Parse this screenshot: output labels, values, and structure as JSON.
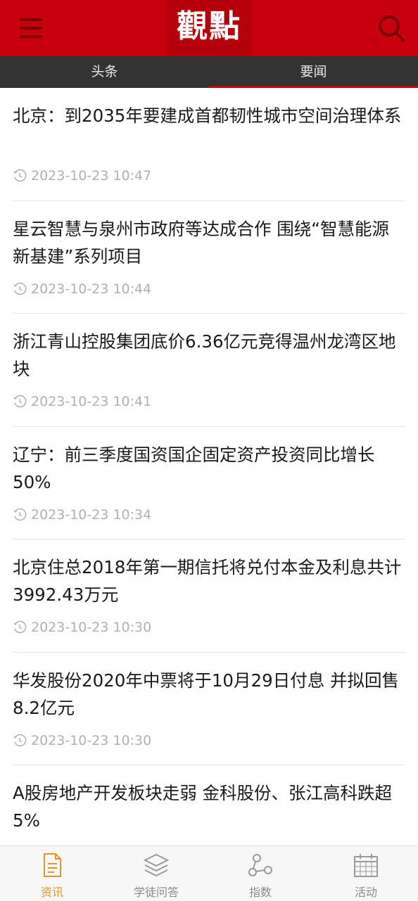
{
  "header": {
    "logo_text": "觀點",
    "menu_icon": "menu-icon",
    "search_icon": "search-icon"
  },
  "tabs": [
    {
      "label": "头条",
      "active": false
    },
    {
      "label": "要闻",
      "active": true
    }
  ],
  "articles": [
    {
      "title": "北京：到2035年要建成首都韧性城市空间治理体系",
      "time": "2023-10-23 10:47"
    },
    {
      "title": "星云智慧与泉州市政府等达成合作 围绕“智慧能源新基建”系列项目",
      "time": "2023-10-23 10:44"
    },
    {
      "title": "浙江青山控股集团底价6.36亿元竞得温州龙湾区地块",
      "time": "2023-10-23 10:41"
    },
    {
      "title": "辽宁：前三季度国资国企固定资产投资同比增长50%",
      "time": "2023-10-23 10:34"
    },
    {
      "title": "北京住总2018年第一期信托将兑付本金及利息共计3992.43万元",
      "time": "2023-10-23 10:30"
    },
    {
      "title": "华发股份2020年中票将于10月29日付息 并拟回售8.2亿元",
      "time": "2023-10-23 10:30"
    },
    {
      "title": "A股房地产开发板块走弱 金科股份、张江高科跌超5%",
      "time": ""
    }
  ],
  "bottom_nav": [
    {
      "label": "资讯",
      "icon": "document-icon",
      "active": true
    },
    {
      "label": "学徒问答",
      "icon": "layers-icon",
      "active": false
    },
    {
      "label": "指数",
      "icon": "nodes-icon",
      "active": false
    },
    {
      "label": "活动",
      "icon": "calendar-icon",
      "active": false
    }
  ],
  "colors": {
    "brand_red": "#c8000e",
    "tab_bar": "#333333",
    "active_nav": "#e0962e"
  }
}
